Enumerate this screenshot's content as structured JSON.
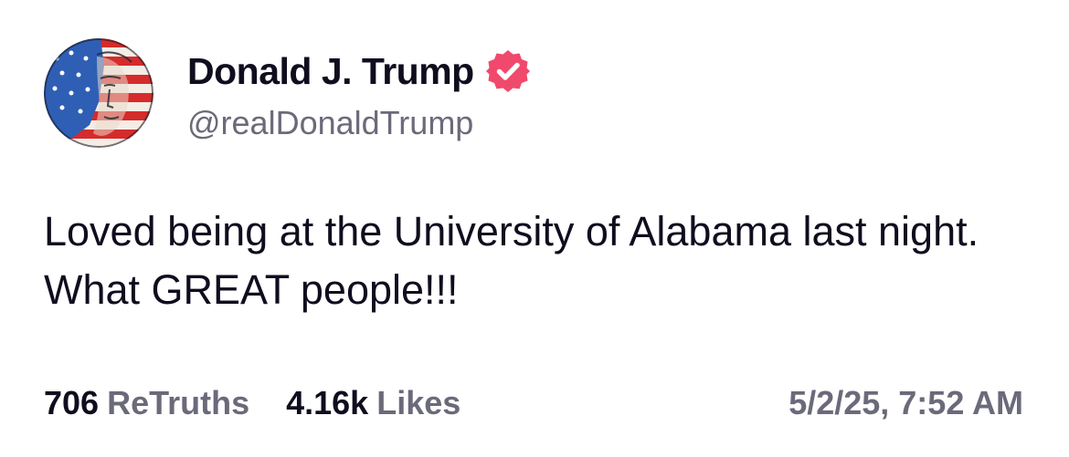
{
  "author": {
    "display_name": "Donald J. Trump",
    "handle": "@realDonaldTrump",
    "verified_icon": "verified-badge-icon",
    "verified_color": "#f0496c",
    "avatar_icon": "profile-avatar"
  },
  "post": {
    "text": "Loved being at the University of Alabama last night. What GREAT people!!!"
  },
  "stats": {
    "retruths_count": "706",
    "retruths_label": "ReTruths",
    "likes_count": "4.16k",
    "likes_label": "Likes"
  },
  "timestamp": "5/2/25, 7:52 AM",
  "colors": {
    "primary_text": "#0f0d1e",
    "secondary_text": "#6b6a7a",
    "background": "#ffffff"
  }
}
